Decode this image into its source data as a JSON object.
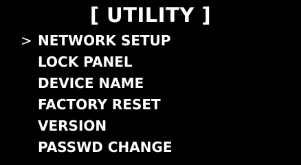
{
  "osd": {
    "title": "[ UTILITY ]",
    "cursor": ">",
    "selected_index": 0,
    "items": [
      {
        "label": "NETWORK SETUP"
      },
      {
        "label": "LOCK PANEL"
      },
      {
        "label": "DEVICE NAME"
      },
      {
        "label": "FACTORY RESET"
      },
      {
        "label": "VERSION"
      },
      {
        "label": "PASSWD CHANGE"
      }
    ],
    "colors": {
      "background": "#000000",
      "text": "#ffffff"
    }
  }
}
